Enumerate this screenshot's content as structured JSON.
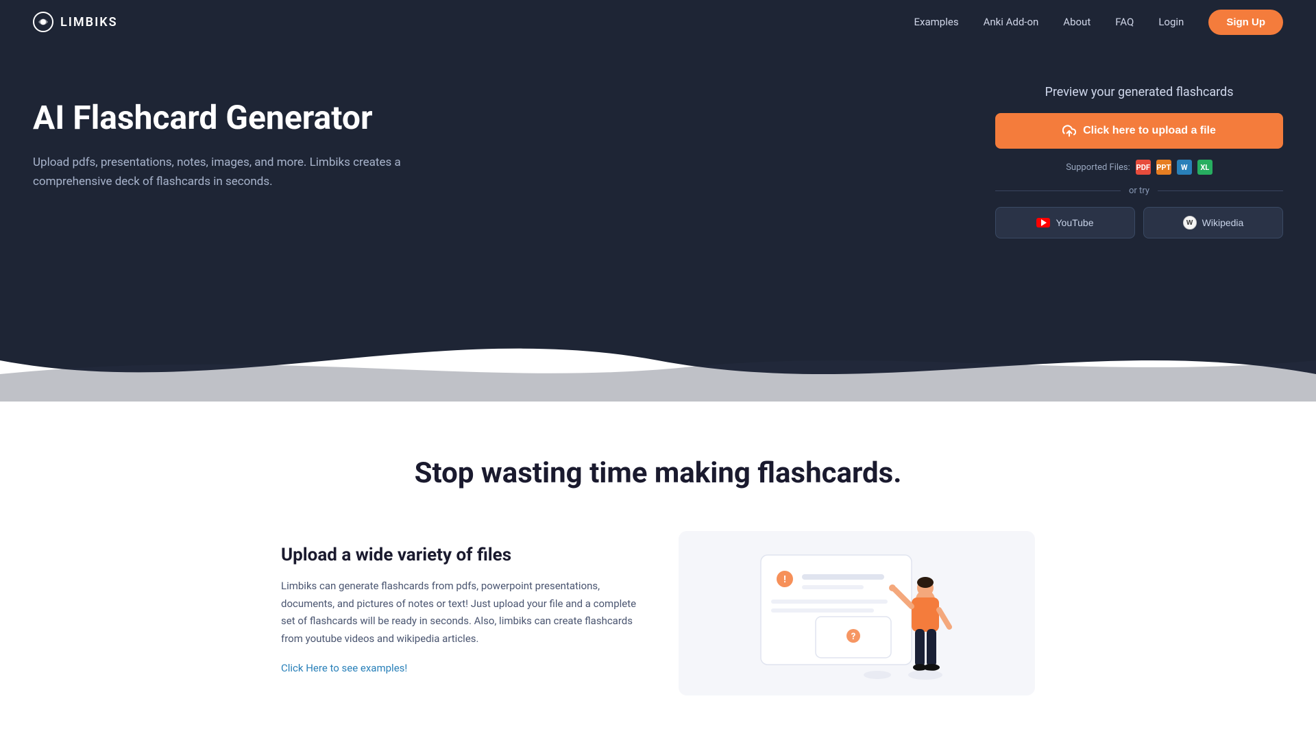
{
  "navbar": {
    "logo_text": "LIMBIKS",
    "links": [
      {
        "label": "Examples",
        "id": "examples"
      },
      {
        "label": "Anki Add-on",
        "id": "anki-addon"
      },
      {
        "label": "About",
        "id": "about"
      },
      {
        "label": "FAQ",
        "id": "faq"
      },
      {
        "label": "Login",
        "id": "login"
      }
    ],
    "signup_label": "Sign Up"
  },
  "hero": {
    "title": "AI Flashcard Generator",
    "subtitle": "Upload pdfs, presentations, notes, images, and more. Limbiks creates a comprehensive deck of flashcards in seconds.",
    "preview_title": "Preview your generated flashcards",
    "upload_button_label": "Click here to upload a file",
    "supported_files_label": "Supported Files:",
    "divider_text": "or try",
    "youtube_label": "YouTube",
    "wikipedia_label": "Wikipedia"
  },
  "section2": {
    "main_heading": "Stop wasting time making flashcards.",
    "feature1": {
      "title": "Upload a wide variety of files",
      "description": "Limbiks can generate flashcards from pdfs, powerpoint presentations, documents, and pictures of notes or text! Just upload your file and a complete set of flashcards will be ready in seconds. Also, limbiks can create flashcards from youtube videos and wikipedia articles.",
      "link_text": "Click Here to see examples!"
    }
  },
  "colors": {
    "accent_orange": "#f47c3c",
    "dark_bg": "#1e2535",
    "text_muted": "#a8b4cc"
  }
}
